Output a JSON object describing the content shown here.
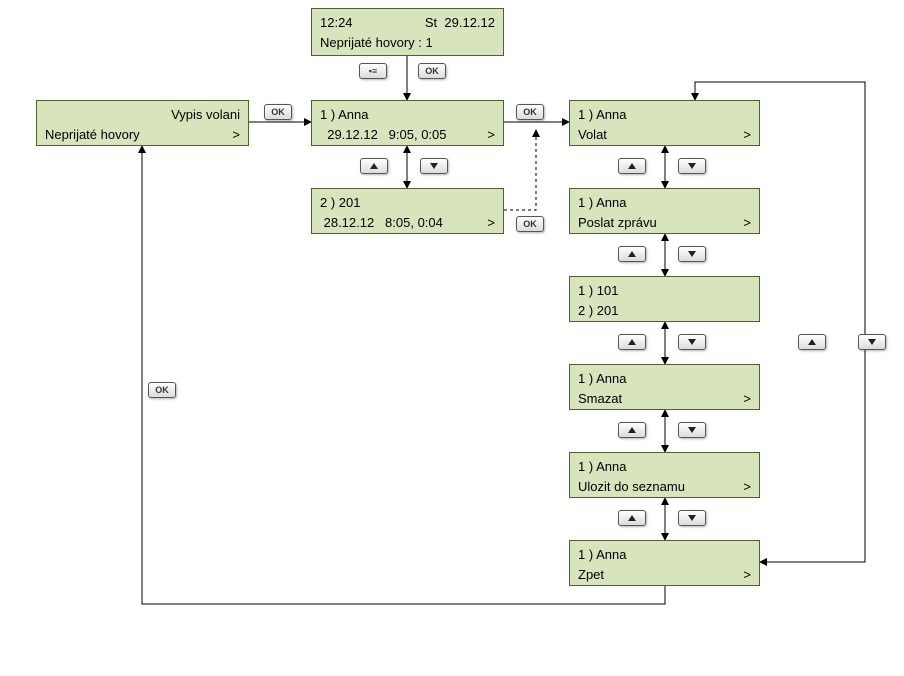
{
  "boxes": {
    "top": {
      "time": "12:24",
      "day": "St",
      "date": "29.12.12",
      "line2": "Neprijaté hovory : 1"
    },
    "left": {
      "title": "Vypis volani",
      "line2": "Neprijaté hovory",
      "arrow": ">"
    },
    "entry1": {
      "line1": "1 ) Anna",
      "indent": "  29.12.12   9:05, 0:05",
      "arrow": ">"
    },
    "entry2": {
      "line1": "2 ) 201",
      "indent": " 28.12.12   8:05, 0:04",
      "arrow": ">"
    },
    "menu1": {
      "line1": "1 ) Anna",
      "label": "Volat",
      "arrow": ">"
    },
    "menu2": {
      "line1": "1 ) Anna",
      "label": "Poslat zprávu",
      "arrow": ">"
    },
    "menu3": {
      "line1": "1 ) 101",
      "line2": "2 ) 201"
    },
    "menu4": {
      "line1": "1 ) Anna",
      "label": "Smazat",
      "arrow": ">"
    },
    "menu5": {
      "line1": "1 ) Anna",
      "label": "Ulozit do seznamu",
      "arrow": ">"
    },
    "menu6": {
      "line1": "1 ) Anna",
      "label": "Zpet",
      "arrow": ">"
    }
  },
  "buttons": {
    "ok": "OK",
    "list": "▪≡"
  }
}
